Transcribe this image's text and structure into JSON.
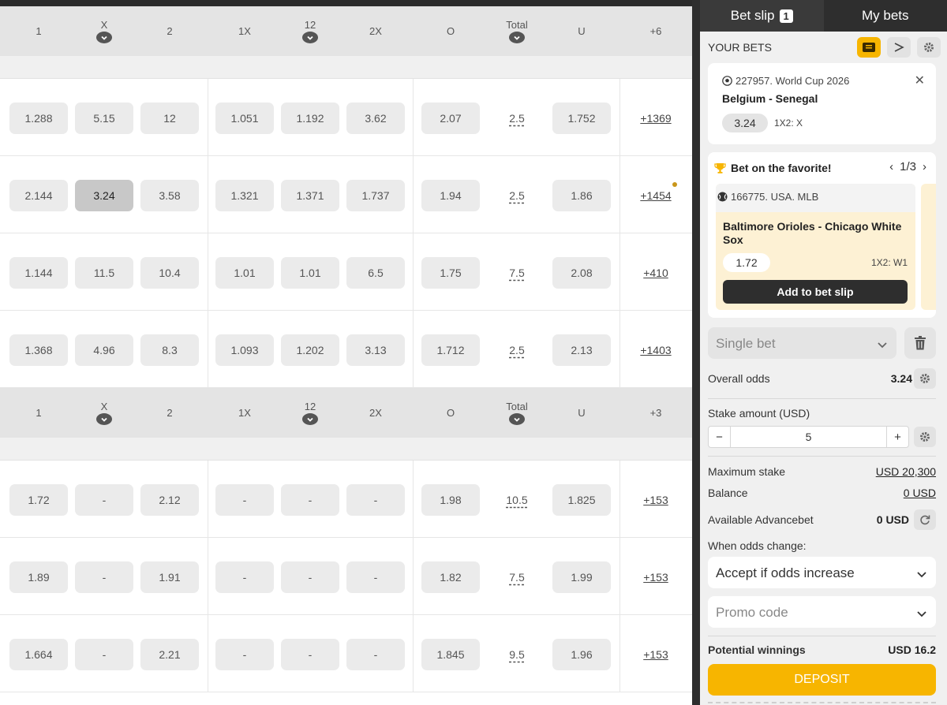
{
  "table": {
    "headers": [
      {
        "cols": [
          {
            "label": "1",
            "chev": false
          },
          {
            "label": "X",
            "chev": true
          },
          {
            "label": "2",
            "chev": false
          },
          {
            "label": "1X",
            "chev": false
          },
          {
            "label": "12",
            "chev": true
          },
          {
            "label": "2X",
            "chev": false
          },
          {
            "label": "O",
            "chev": false
          },
          {
            "label": "Total",
            "chev": true
          },
          {
            "label": "U",
            "chev": false
          },
          {
            "label": "+6",
            "chev": false
          }
        ]
      },
      {
        "cols": [
          {
            "label": "1",
            "chev": false
          },
          {
            "label": "X",
            "chev": true
          },
          {
            "label": "2",
            "chev": false
          },
          {
            "label": "1X",
            "chev": false
          },
          {
            "label": "12",
            "chev": true
          },
          {
            "label": "2X",
            "chev": false
          },
          {
            "label": "O",
            "chev": false
          },
          {
            "label": "Total",
            "chev": true
          },
          {
            "label": "U",
            "chev": false
          },
          {
            "label": "+3",
            "chev": false
          }
        ]
      }
    ],
    "sections": [
      {
        "rows": [
          {
            "w1": "1.288",
            "x": "5.15",
            "w2": "12",
            "d1x": "1.051",
            "d12": "1.192",
            "d2x": "3.62",
            "over": "2.07",
            "total": "2.5",
            "under": "1.752",
            "more": "+1369",
            "selected": "",
            "dot": false
          },
          {
            "w1": "2.144",
            "x": "3.24",
            "w2": "3.58",
            "d1x": "1.321",
            "d12": "1.371",
            "d2x": "1.737",
            "over": "1.94",
            "total": "2.5",
            "under": "1.86",
            "more": "+1454",
            "selected": "x",
            "dot": true
          },
          {
            "w1": "1.144",
            "x": "11.5",
            "w2": "10.4",
            "d1x": "1.01",
            "d12": "1.01",
            "d2x": "6.5",
            "over": "1.75",
            "total": "7.5",
            "under": "2.08",
            "more": "+410",
            "selected": "",
            "dot": false
          },
          {
            "w1": "1.368",
            "x": "4.96",
            "w2": "8.3",
            "d1x": "1.093",
            "d12": "1.202",
            "d2x": "3.13",
            "over": "1.712",
            "total": "2.5",
            "under": "2.13",
            "more": "+1403",
            "selected": "",
            "dot": false
          }
        ]
      },
      {
        "rows": [
          {
            "w1": "1.72",
            "x": "-",
            "w2": "2.12",
            "d1x": "-",
            "d12": "-",
            "d2x": "-",
            "over": "1.98",
            "total": "10.5",
            "under": "1.825",
            "more": "+153",
            "selected": "",
            "dot": false
          },
          {
            "w1": "1.89",
            "x": "-",
            "w2": "1.91",
            "d1x": "-",
            "d12": "-",
            "d2x": "-",
            "over": "1.82",
            "total": "7.5",
            "under": "1.99",
            "more": "+153",
            "selected": "",
            "dot": false
          },
          {
            "w1": "1.664",
            "x": "-",
            "w2": "2.21",
            "d1x": "-",
            "d12": "-",
            "d2x": "-",
            "over": "1.845",
            "total": "9.5",
            "under": "1.96",
            "more": "+153",
            "selected": "",
            "dot": false
          }
        ]
      }
    ]
  },
  "sidebar": {
    "tabs": {
      "betslip": "Bet slip",
      "betslip_count": "1",
      "mybets": "My bets"
    },
    "your_bets": "YOUR BETS",
    "bet": {
      "league": "227957. World Cup 2026",
      "match": "Belgium - Senegal",
      "odd": "3.24",
      "type": "1X2: X"
    },
    "favorite": {
      "title": "Bet on the favorite!",
      "pager": "1/3",
      "league": "166775. USA. MLB",
      "match": "Baltimore Orioles - Chicago White Sox",
      "odd": "1.72",
      "type": "1X2: W1",
      "add_label": "Add to bet slip"
    },
    "bet_type": "Single bet",
    "overall_odds_label": "Overall odds",
    "overall_odds": "3.24",
    "stake_label": "Stake amount (USD)",
    "stake_value": "5",
    "minus": "−",
    "plus": "+",
    "max_stake_label": "Maximum stake",
    "max_stake": "USD 20,300",
    "balance_label": "Balance",
    "balance": "0 USD",
    "advancebet_label": "Available Advancebet",
    "advancebet": "0 USD",
    "odds_change_label": "When odds change:",
    "odds_change_value": "Accept if odds increase",
    "promo_placeholder": "Promo code",
    "potential_label": "Potential winnings",
    "potential_value": "USD 16.2",
    "deposit_label": "DEPOSIT"
  },
  "colors": {
    "accent": "#f7b500",
    "dark": "#2e2e2e"
  }
}
